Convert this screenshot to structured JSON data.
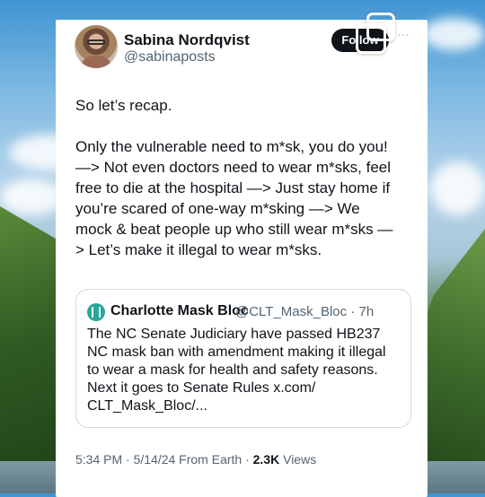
{
  "author": {
    "name": "Sabina Nordqvist",
    "handle": "@sabinaposts",
    "follow_label": "Follow",
    "more_label": "···"
  },
  "post": {
    "lines": [
      "So let’s recap.",
      "",
      "Only the vulnerable need to m*sk, you do you!",
      "—> Not even doctors need to wear m*sks, feel",
      "free to die at the hospital —> Just stay home if",
      "you’re scared of one-way m*sking —> We",
      "mock & beat people up who still wear m*sks —",
      "> Let’s make it illegal to wear m*sks."
    ]
  },
  "quote": {
    "name": "Charlotte Mask Bloc",
    "handle_time": "@CLT_Mask_Bloc · 7h",
    "lines": [
      "The NC Senate Judiciary have passed HB237",
      "NC mask ban with amendment making it illegal",
      "to wear a mask for health and safety reasons.",
      "Next it goes to Senate Rules x.com/",
      "CLT_Mask_Bloc/..."
    ]
  },
  "footer": {
    "meta": "5:34 PM · 5/14/24 From Earth · ",
    "views_count": "2.3K",
    "views_label": " Views"
  },
  "colors": {
    "text": "#0f1419",
    "secondary": "#536471",
    "follow_bg": "#0f1419",
    "border": "#cfd9de"
  },
  "icons": {
    "more": "more-dots-icon",
    "copy": "copy-icon",
    "quote_avatar": "charlotte-mask-bloc-avatar"
  }
}
